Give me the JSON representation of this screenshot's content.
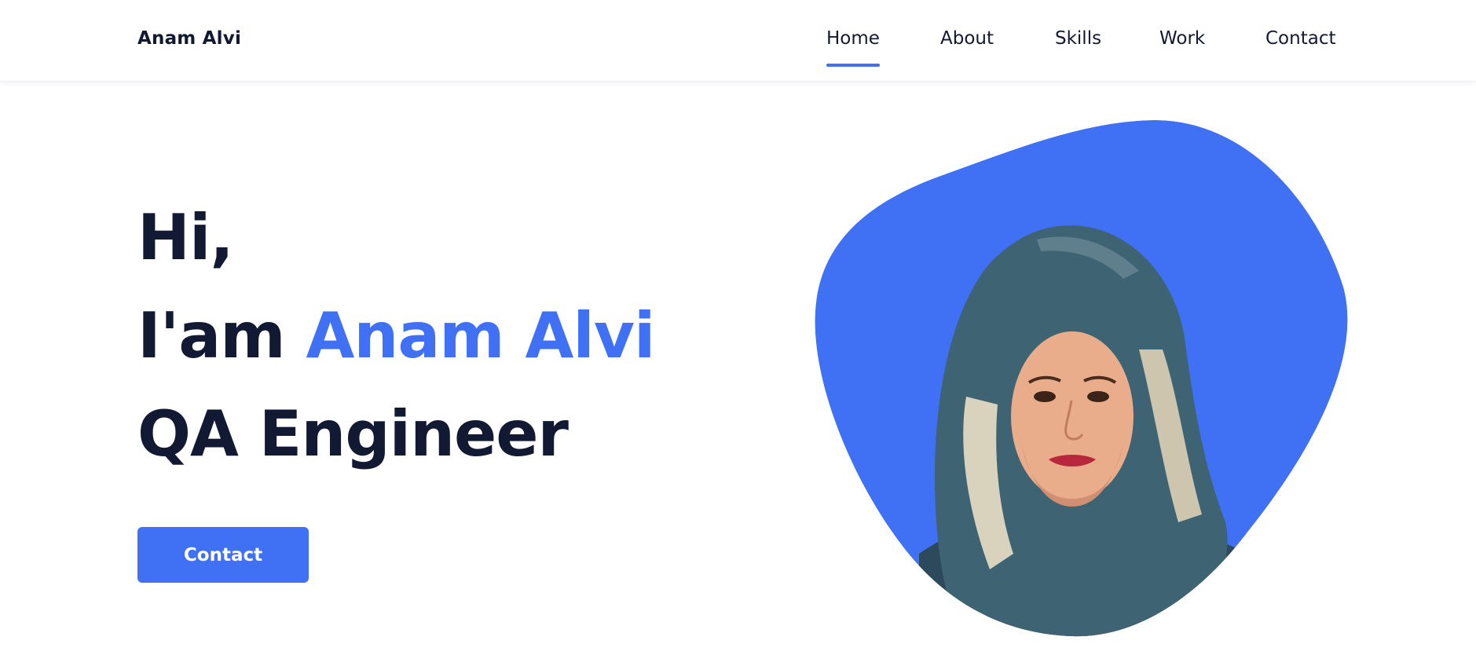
{
  "header": {
    "logo_text": "Anam Alvi",
    "nav": [
      {
        "label": "Home",
        "active": true
      },
      {
        "label": "About",
        "active": false
      },
      {
        "label": "Skills",
        "active": false
      },
      {
        "label": "Work",
        "active": false
      },
      {
        "label": "Contact",
        "active": false
      }
    ]
  },
  "hero": {
    "greeting": "Hi,",
    "intro_prefix": "I'am ",
    "name": "Anam Alvi",
    "role": "QA Engineer",
    "cta_label": "Contact"
  },
  "colors": {
    "accent": "#4070f4",
    "text_dark": "#121a33",
    "background": "#ffffff"
  }
}
